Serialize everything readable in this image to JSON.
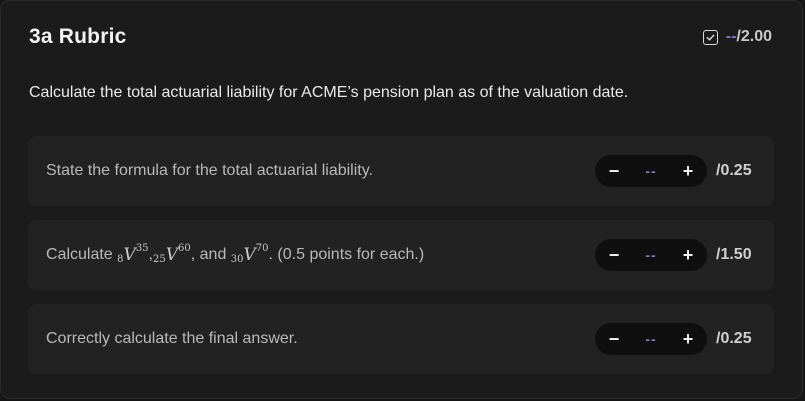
{
  "header": {
    "title": "3a Rubric",
    "score_value": "--",
    "score_max": "/2.00"
  },
  "question": "Calculate the total actuarial liability for ACME’s pension plan as of the valuation date.",
  "items": [
    {
      "label": "State the formula for the total actuarial liability.",
      "value": "--",
      "max": "/0.25"
    },
    {
      "label_parts": {
        "prefix": "Calculate ",
        "t1_sub": "8",
        "t1_sup": "35",
        "sep1": ", ",
        "t2_sub": "25",
        "t2_sup": "60",
        "sep2": ", and ",
        "t3_sub": "30",
        "t3_sup": "70",
        "suffix": ". (0.5 points for each.)",
        "symbol": "V"
      },
      "value": "--",
      "max": "/1.50"
    },
    {
      "label": "Correctly calculate the final answer.",
      "value": "--",
      "max": "/0.25"
    }
  ],
  "controls": {
    "minus": "−",
    "plus": "+"
  },
  "colors": {
    "accent": "#7d79c9",
    "panel": "#1b1b1c",
    "item_bg": "#222223",
    "stepper_bg": "#0f0f10"
  }
}
